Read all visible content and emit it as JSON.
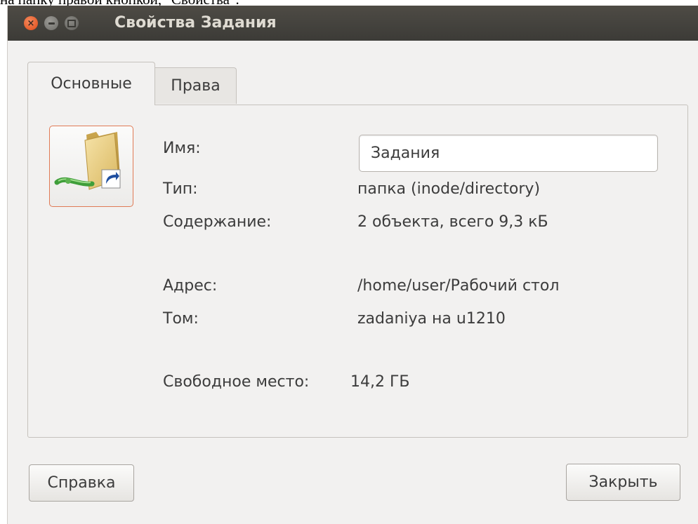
{
  "document": {
    "top_line": "на папку правой кнопкой, \"Свойства\"."
  },
  "window": {
    "title": "Свойства Задания",
    "controls": [
      {
        "name": "close",
        "symbol": "×"
      },
      {
        "name": "minimize",
        "symbol": ""
      },
      {
        "name": "maximize",
        "symbol": ""
      }
    ]
  },
  "tabs": [
    {
      "label": "Основные",
      "active": true
    },
    {
      "label": "Права",
      "active": false
    }
  ],
  "icon": {
    "semantic": "folder-link-icon",
    "accent_color": "#e07a55"
  },
  "fields": {
    "name": {
      "label": "Имя:",
      "value": "Задания"
    },
    "type": {
      "label": "Тип:",
      "value": "папка (inode/directory)"
    },
    "contents": {
      "label": "Содержание:",
      "value": "2 объекта, всего 9,3 кБ"
    },
    "location": {
      "label": "Адрес:",
      "value": "/home/user/Рабочий стол"
    },
    "volume": {
      "label": "Том:",
      "value": "zadaniya на u1210"
    },
    "free_space": {
      "label": "Свободное место:",
      "value": "14,2 ГБ"
    }
  },
  "buttons": {
    "help": "Справка",
    "close": "Закрыть"
  }
}
